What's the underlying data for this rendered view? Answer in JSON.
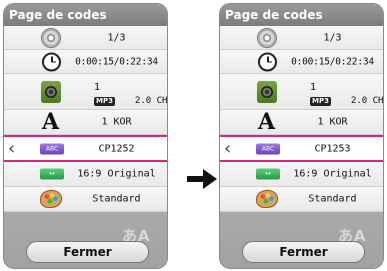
{
  "panels": [
    {
      "title": "Page de codes",
      "rows": {
        "title_num": "1/3",
        "time": "0:00:15/0:22:34",
        "audio_track": "1",
        "audio_format": "MP3",
        "audio_channels": "2.0 CH",
        "subtitle_lang": "1 KOR",
        "code_page": "CP1252",
        "aspect": "16:9 Original",
        "picture_mode": "Standard"
      },
      "icons": {
        "abc": "ABC",
        "ratio": "↔"
      },
      "footer_deco": "あA",
      "close_label": "Fermer"
    },
    {
      "title": "Page de codes",
      "rows": {
        "title_num": "1/3",
        "time": "0:00:15/0:22:34",
        "audio_track": "1",
        "audio_format": "MP3",
        "audio_channels": "2.0 CH",
        "subtitle_lang": "1 KOR",
        "code_page": "CP1253",
        "aspect": "16:9 Original",
        "picture_mode": "Standard"
      },
      "icons": {
        "abc": "ABC",
        "ratio": "↔"
      },
      "footer_deco": "あA",
      "close_label": "Fermer"
    }
  ],
  "arrow_glyph": "‹",
  "colors": {
    "selection": "#d6277a",
    "title_bar": "#888888"
  }
}
